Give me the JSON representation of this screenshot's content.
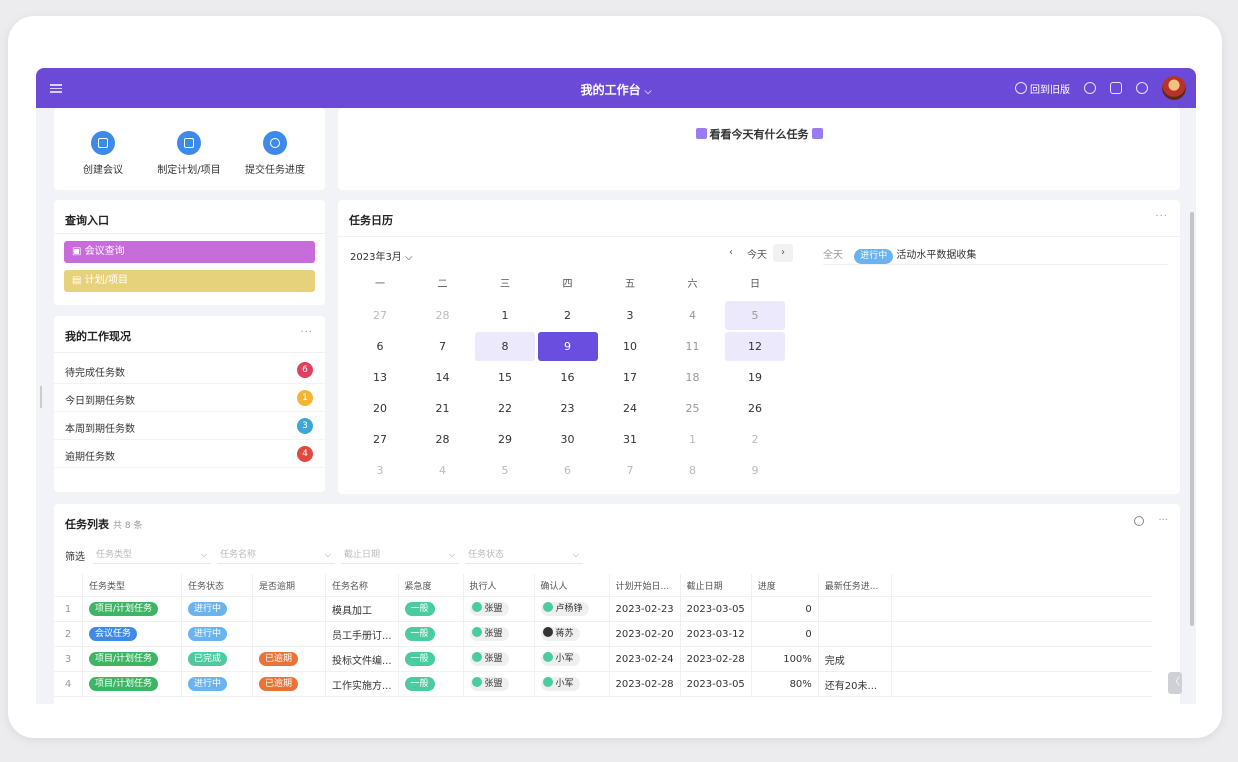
{
  "topbar": {
    "title": "我的工作台",
    "title_chevron": "⌵",
    "old_version": "回到旧版"
  },
  "quick_actions": [
    {
      "label": "创建会议"
    },
    {
      "label": "制定计划/项目"
    },
    {
      "label": "提交任务进度"
    }
  ],
  "banner": {
    "text": "看看今天有什么任务"
  },
  "query": {
    "title": "查询入口",
    "buttons": [
      "会议查询",
      "计划/项目"
    ],
    "colors": [
      "#c86cdc",
      "#e6d27a"
    ]
  },
  "work_status": {
    "title": "我的工作现况",
    "more": "···",
    "items": [
      {
        "label": "待完成任务数",
        "count": "6",
        "color": "#e0405e"
      },
      {
        "label": "今日到期任务数",
        "count": "1",
        "color": "#f2b534"
      },
      {
        "label": "本周到期任务数",
        "count": "3",
        "color": "#3fa7d8"
      },
      {
        "label": "逾期任务数",
        "count": "4",
        "color": "#e2493c"
      }
    ]
  },
  "calendar": {
    "title": "任务日历",
    "more": "···",
    "month": "2023年3月 ⌵",
    "prev": "‹",
    "today": "今天",
    "next": "›",
    "weekdays": [
      "一",
      "二",
      "三",
      "四",
      "五",
      "六",
      "日"
    ],
    "weeks": [
      [
        "27",
        "28",
        "1",
        "2",
        "3",
        "4",
        "5"
      ],
      [
        "6",
        "7",
        "8",
        "9",
        "10",
        "11",
        "12"
      ],
      [
        "13",
        "14",
        "15",
        "16",
        "17",
        "18",
        "19"
      ],
      [
        "20",
        "21",
        "22",
        "23",
        "24",
        "25",
        "26"
      ],
      [
        "27",
        "28",
        "29",
        "30",
        "31",
        "1",
        "2"
      ],
      [
        "3",
        "4",
        "5",
        "6",
        "7",
        "8",
        "9"
      ]
    ],
    "selected_day": "9",
    "event": {
      "allday": "全天",
      "status": "进行中",
      "name": "活动水平数据收集"
    }
  },
  "task_list": {
    "title": "任务列表",
    "count": "共 8 条",
    "more": "···",
    "filter_label": "筛选",
    "filters": [
      "任务类型",
      "任务名称",
      "截止日期",
      "任务状态"
    ],
    "columns": [
      "任务类型",
      "任务状态",
      "是否逾期",
      "任务名称",
      "紧急度",
      "执行人",
      "确认人",
      "计划开始日...",
      "截止日期",
      "进度",
      "最新任务进..."
    ],
    "rows": [
      {
        "idx": "1",
        "type": "项目/计划任务",
        "status": "进行中",
        "overdue": "",
        "name": "模具加工",
        "urgency": "一般",
        "executor": "张盟",
        "confirmer": "卢杨铮",
        "start": "2023-02-23",
        "due": "2023-03-05",
        "progress": "0",
        "latest": ""
      },
      {
        "idx": "2",
        "type": "会议任务",
        "status": "进行中",
        "overdue": "",
        "name": "员工手册订...",
        "urgency": "一般",
        "executor": "张盟",
        "confirmer": "蒋苏",
        "start": "2023-02-20",
        "due": "2023-03-12",
        "progress": "0",
        "latest": ""
      },
      {
        "idx": "3",
        "type": "项目/计划任务",
        "status": "已完成",
        "overdue": "已逾期",
        "name": "投标文件编...",
        "urgency": "一般",
        "executor": "张盟",
        "confirmer": "小军",
        "start": "2023-02-24",
        "due": "2023-02-28",
        "progress": "100%",
        "latest": "完成"
      },
      {
        "idx": "4",
        "type": "项目/计划任务",
        "status": "进行中",
        "overdue": "已逾期",
        "name": "工作实施方...",
        "urgency": "一般",
        "executor": "张盟",
        "confirmer": "小军",
        "start": "2023-02-28",
        "due": "2023-03-05",
        "progress": "80%",
        "latest": "还有20未..."
      }
    ]
  },
  "expand_handle": "〈"
}
